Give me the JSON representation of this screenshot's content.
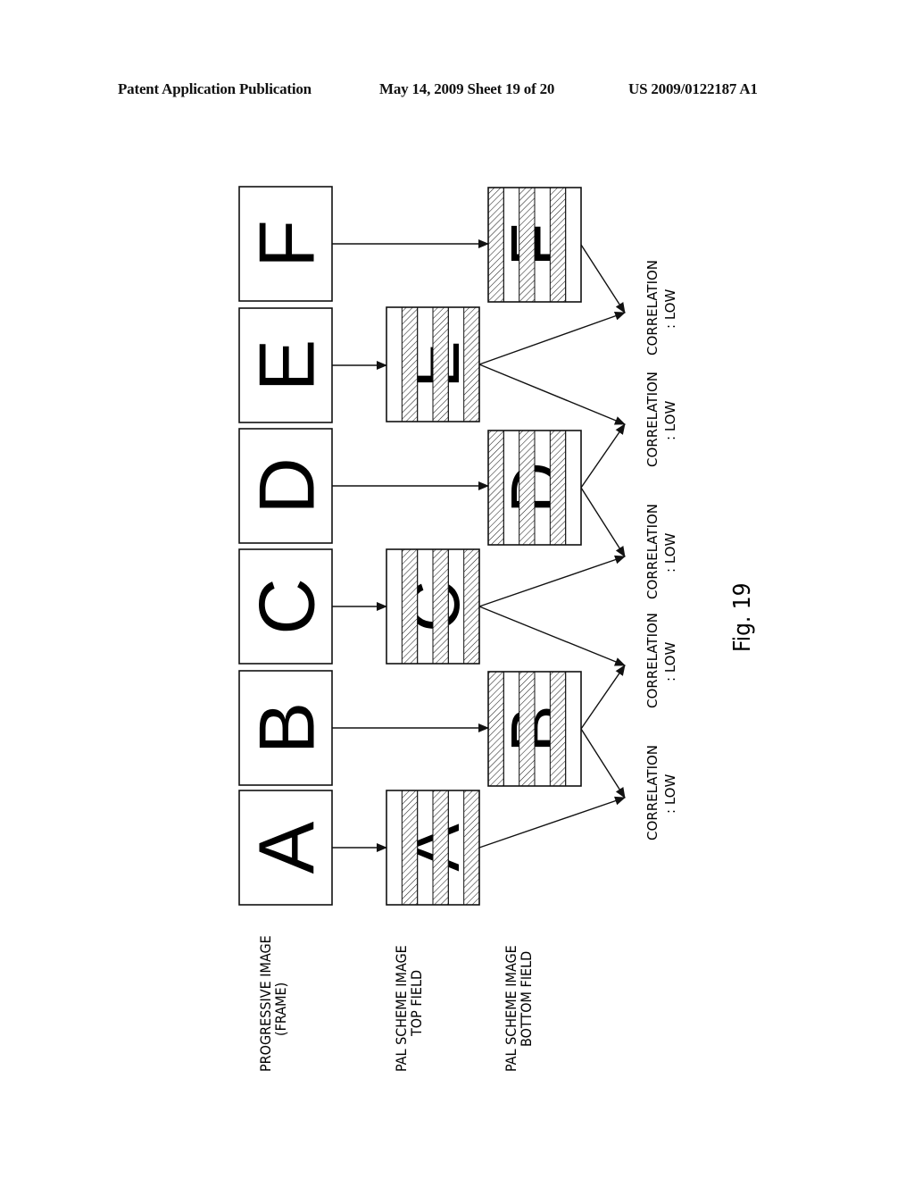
{
  "header": {
    "publication": "Patent Application Publication",
    "date_sheet": "May 14, 2009   Sheet 19 of 20",
    "number": "US 2009/0122187 A1"
  },
  "row_labels": [
    {
      "line1": "PROGRESSIVE IMAGE",
      "line2": "(FRAME)"
    },
    {
      "line1": "PAL SCHEME IMAGE",
      "line2": "TOP FIELD"
    },
    {
      "line1": "PAL SCHEME IMAGE",
      "line2": "BOTTOM FIELD"
    }
  ],
  "frames": [
    "A",
    "B",
    "C",
    "D",
    "E",
    "F"
  ],
  "top_fields": [
    "A",
    "C",
    "E"
  ],
  "bottom_fields": [
    "B",
    "D",
    "F"
  ],
  "correlations": [
    {
      "line1": "CORRELATION",
      "line2": ": LOW"
    },
    {
      "line1": "CORRELATION",
      "line2": ": LOW"
    },
    {
      "line1": "CORRELATION",
      "line2": ": LOW"
    },
    {
      "line1": "CORRELATION",
      "line2": ": LOW"
    },
    {
      "line1": "CORRELATION",
      "line2": ": LOW"
    }
  ],
  "figure_label": "Fig. 19"
}
